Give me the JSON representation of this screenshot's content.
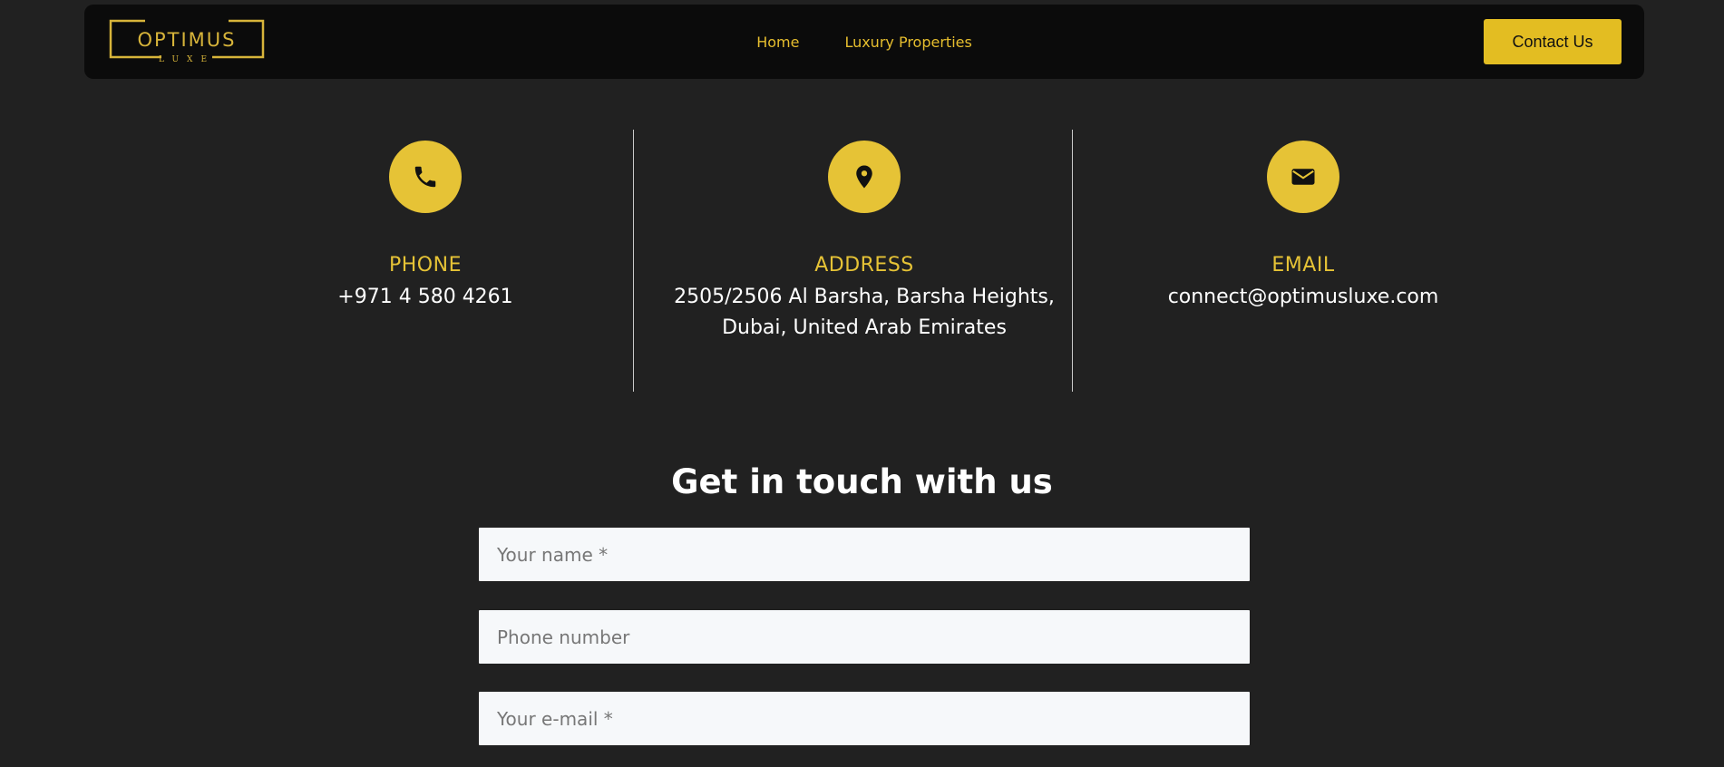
{
  "header": {
    "logo": {
      "name": "OPTIMUS",
      "tagline": "LUXE"
    },
    "nav": [
      {
        "label": "Home"
      },
      {
        "label": "Luxury Properties"
      }
    ],
    "contact_button": "Contact Us"
  },
  "info": [
    {
      "icon": "phone-icon",
      "title": "PHONE",
      "text": "+971 4 580 4261"
    },
    {
      "icon": "location-pin-icon",
      "title": "ADDRESS",
      "text": "2505/2506 Al Barsha, Barsha Heights,\nDubai, United Arab Emirates"
    },
    {
      "icon": "envelope-icon",
      "title": "EMAIL",
      "text": "connect@optimusluxe.com"
    }
  ],
  "form": {
    "heading": "Get in touch with us",
    "fields": [
      {
        "placeholder": "Your name *",
        "value": ""
      },
      {
        "placeholder": "Phone number",
        "value": ""
      },
      {
        "placeholder": "Your e-mail *",
        "value": ""
      }
    ]
  },
  "colors": {
    "background": "#212121",
    "navbar": "#0b0b0b",
    "accent": "#e6c336",
    "button": "#e3bd22",
    "text": "#ffffff"
  }
}
